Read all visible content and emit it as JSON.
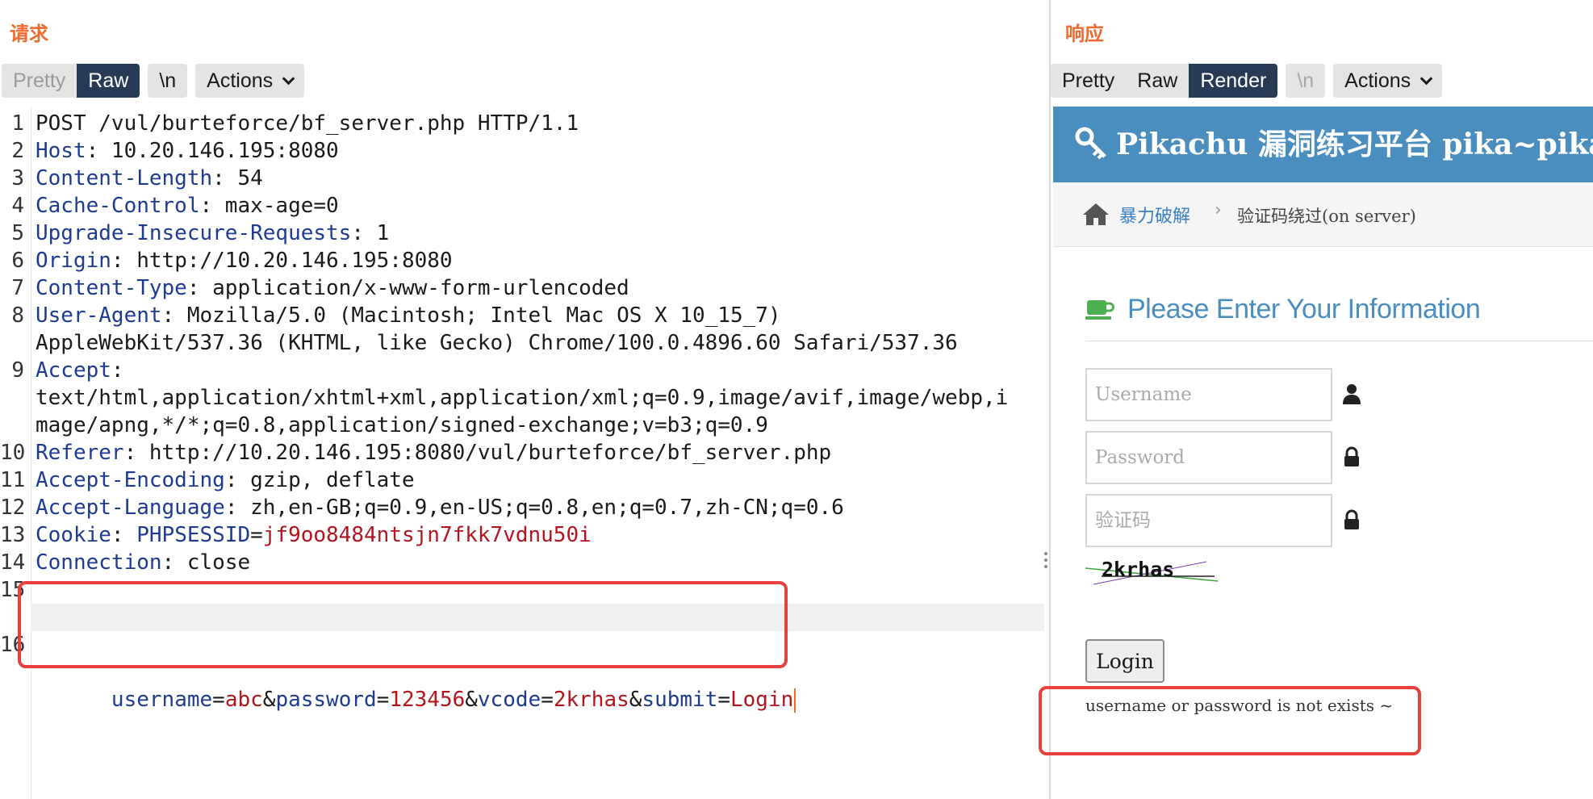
{
  "request": {
    "title": "请求",
    "tabs": {
      "pretty": "Pretty",
      "raw": "Raw"
    },
    "newline_label": "\\n",
    "actions_label": "Actions",
    "lines": [
      {
        "n": "1",
        "text": "POST /vul/burteforce/bf_server.php HTTP/1.1"
      },
      {
        "n": "2",
        "key": "Host",
        "value": ": 10.20.146.195:8080"
      },
      {
        "n": "3",
        "key": "Content-Length",
        "value": ": 54"
      },
      {
        "n": "4",
        "key": "Cache-Control",
        "value": ": max-age=0"
      },
      {
        "n": "5",
        "key": "Upgrade-Insecure-Requests",
        "value": ": 1"
      },
      {
        "n": "6",
        "key": "Origin",
        "value": ": http://10.20.146.195:8080"
      },
      {
        "n": "7",
        "key": "Content-Type",
        "value": ": application/x-www-form-urlencoded"
      },
      {
        "n": "8",
        "key": "User-Agent",
        "value": ": Mozilla/5.0 (Macintosh; Intel Mac OS X 10_15_7)"
      },
      {
        "n": "",
        "text": "AppleWebKit/537.36 (KHTML, like Gecko) Chrome/100.0.4896.60 Safari/537.36"
      },
      {
        "n": "9",
        "key": "Accept",
        "value": ":"
      },
      {
        "n": "",
        "text": "text/html,application/xhtml+xml,application/xml;q=0.9,image/avif,image/webp,i"
      },
      {
        "n": "",
        "text": "mage/apng,*/*;q=0.8,application/signed-exchange;v=b3;q=0.9"
      },
      {
        "n": "10",
        "key": "Referer",
        "value": ": http://10.20.146.195:8080/vul/burteforce/bf_server.php"
      },
      {
        "n": "11",
        "key": "Accept-Encoding",
        "value": ": gzip, deflate"
      },
      {
        "n": "12",
        "key": "Accept-Language",
        "value": ": zh,en-GB;q=0.9,en-US;q=0.8,en;q=0.7,zh-CN;q=0.6"
      },
      {
        "n": "13",
        "key": "Cookie",
        "value": ": ",
        "cookie_name": "PHPSESSID",
        "cookie_eq": "=",
        "cookie_value": "jf9oo8484ntsjn7fkk7vdnu50i"
      },
      {
        "n": "14",
        "key": "Connection",
        "value": ": close"
      },
      {
        "n": "15",
        "text": ""
      }
    ],
    "body_line": {
      "n": "16",
      "params": [
        {
          "k": "username",
          "v": "abc"
        },
        {
          "k": "password",
          "v": "123456"
        },
        {
          "k": "vcode",
          "v": "2krhas"
        },
        {
          "k": "submit",
          "v": "Login"
        }
      ]
    }
  },
  "response": {
    "title": "响应",
    "tabs": {
      "pretty": "Pretty",
      "raw": "Raw",
      "render": "Render"
    },
    "newline_label": "\\n",
    "actions_label": "Actions",
    "page": {
      "site_title": "Pikachu 漏洞练习平台 pika~pika~",
      "breadcrumb_link": "暴力破解",
      "breadcrumb_sep": "›",
      "breadcrumb_current": "验证码绕过(on server)",
      "heading": "Please Enter Your Information",
      "username_placeholder": "Username",
      "password_placeholder": "Password",
      "vcode_placeholder": "验证码",
      "captcha_text": "2krhas",
      "login_label": "Login",
      "result_message": "username or password is not exists ~"
    }
  },
  "colors": {
    "title_orange": "#ef6a2d",
    "active_tab": "#283b56",
    "header_key": "#1f3a93",
    "param_value": "#b5141c",
    "pikachu_blue": "#4a8dbf",
    "highlight_red": "#e8403c"
  },
  "icons": [
    "chevron-down-icon",
    "key-icon",
    "home-icon",
    "coffee-cup-icon",
    "user-icon",
    "lock-icon"
  ]
}
